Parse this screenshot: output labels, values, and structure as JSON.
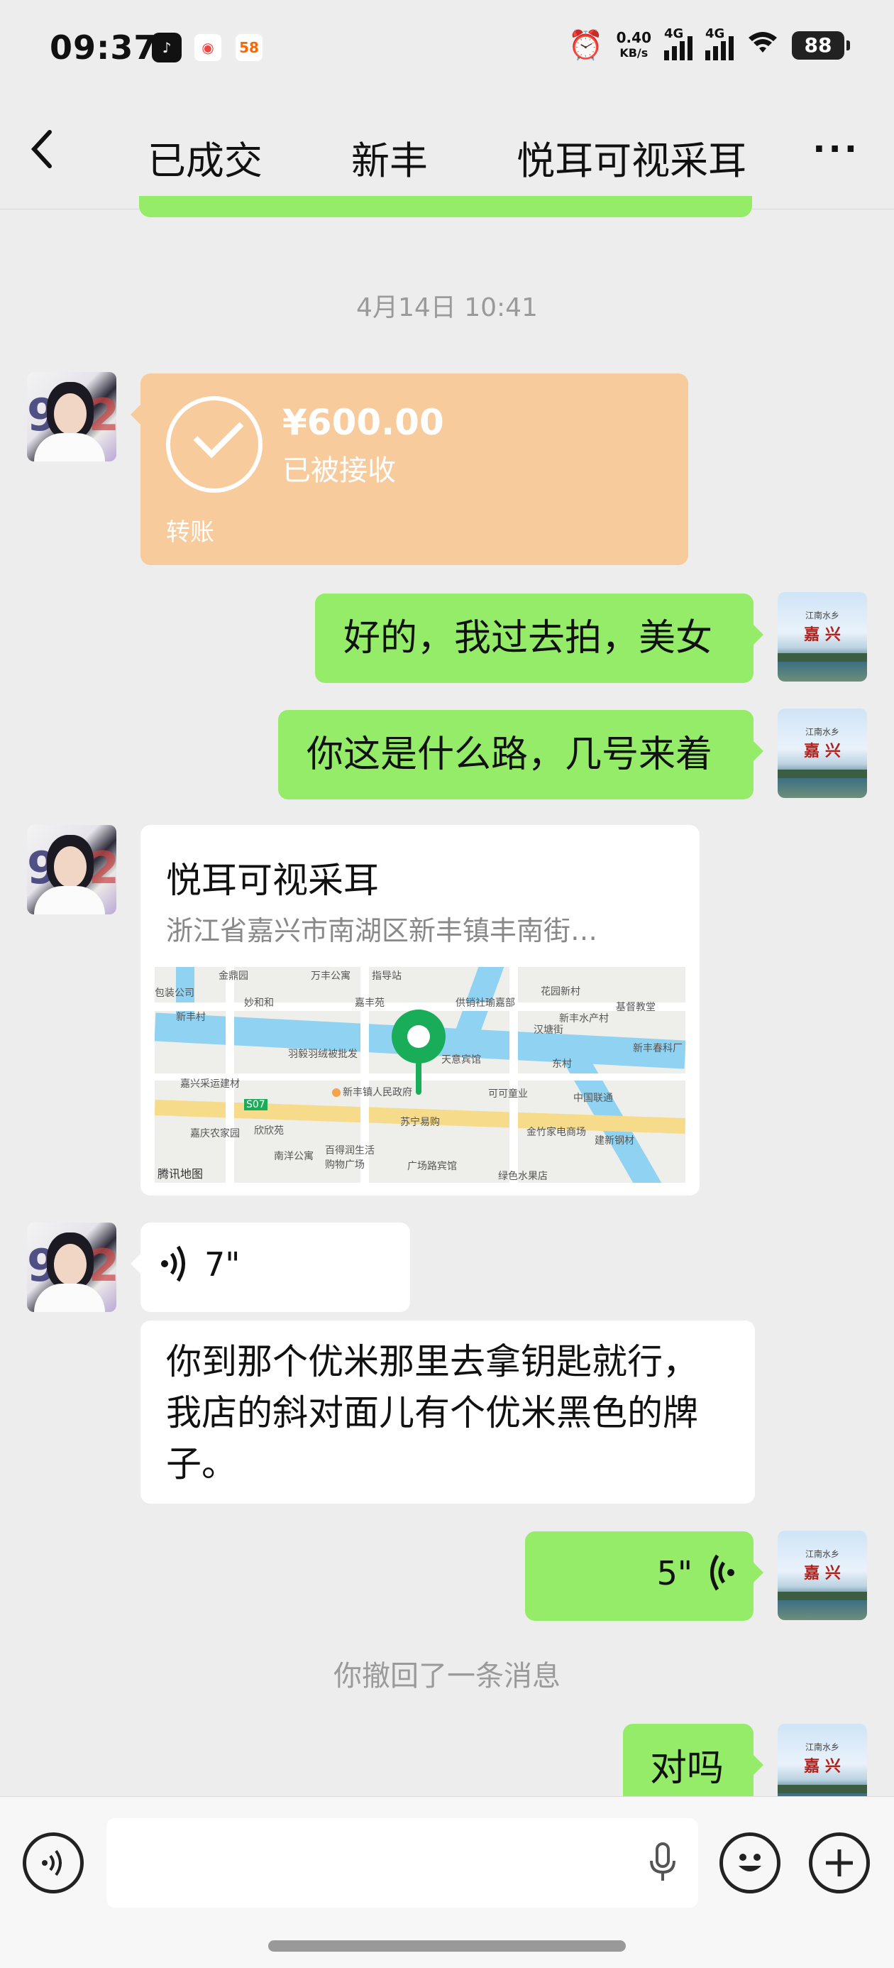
{
  "status_bar": {
    "time": "09:37",
    "apps": [
      "tiktok-icon",
      "weibo-icon",
      "58-icon"
    ],
    "app_58_label": "58",
    "net_speed_value": "0.40",
    "net_speed_unit": "KB/s",
    "signal_1_label": "4G",
    "signal_2_label": "4G",
    "battery": "88"
  },
  "header": {
    "back_icon": "chevron-left-icon",
    "title_parts": [
      "已成交",
      "新丰",
      "悦耳可视采耳"
    ],
    "more_label": "···"
  },
  "chat": {
    "timestamp": "4月14日 10:41",
    "transfer": {
      "amount": "¥600.00",
      "status": "已被接收",
      "label": "转账"
    },
    "messages": [
      {
        "side": "right",
        "text": "好的，我过去拍，美女"
      },
      {
        "side": "right",
        "text": "你这是什么路，几号来着"
      }
    ],
    "location": {
      "name": "悦耳可视采耳",
      "address": "浙江省嘉兴市南湖区新丰镇丰南街…",
      "map_credit": "腾讯地图",
      "map_pois": [
        "金鼎园",
        "万丰公寓",
        "指导站",
        "花园新村",
        "基督教堂",
        "新丰村",
        "包装公司",
        "妙和和",
        "嘉丰苑",
        "供销社瑜嘉部",
        "汉塘街",
        "新丰水产村",
        "新丰春科厂",
        "羽毅羽绒被批发",
        "天意宾馆",
        "东村",
        "嘉兴采运建材",
        "新丰镇人民政府",
        "可可童业",
        "中国联通",
        "S07",
        "嘉庆农家园",
        "欣欣苑",
        "苏宁易购",
        "金竹家电商场",
        "建新钢材",
        "南洋公寓",
        "百得润生活购物广场",
        "广场路宾馆",
        "绿色水果店"
      ]
    },
    "voice_in": {
      "duration": "7\""
    },
    "text_in": "你到那个优米那里去拿钥匙就行，我店的斜对面儿有个优米黑色的牌子。",
    "voice_out": {
      "duration": "5\""
    },
    "recall_notice": "你撤回了一条消息",
    "last_message": "对吗"
  },
  "input_bar": {
    "voice_toggle_icon": "voice-icon",
    "mic_icon": "microphone-icon",
    "emoji_icon": "emoji-icon",
    "plus_icon": "plus-icon"
  },
  "colors": {
    "background": "#ededed",
    "sent_bubble": "#95ec69",
    "transfer_bubble": "#f7cb9b",
    "map_pin": "#19ad5a"
  }
}
